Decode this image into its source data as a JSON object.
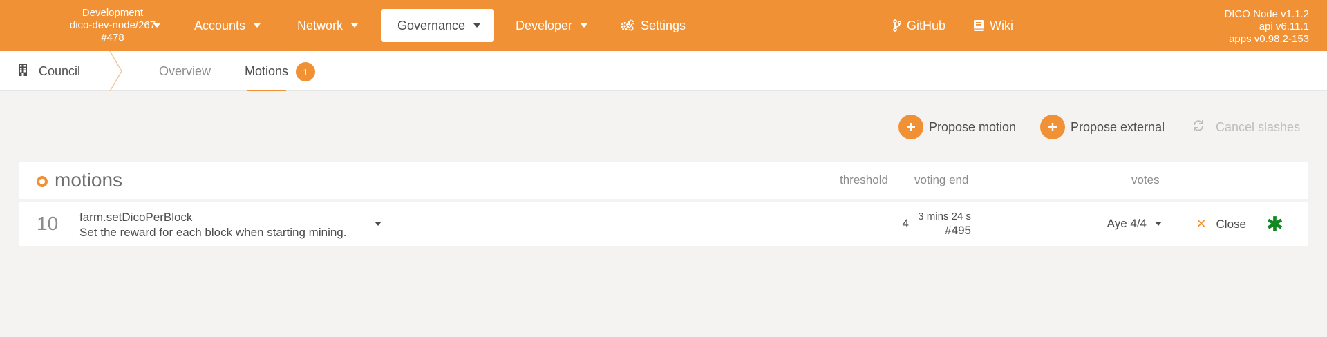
{
  "colors": {
    "brand": "#f19135",
    "success": "#128820",
    "disabled": "#bdbdbd"
  },
  "header": {
    "chain": {
      "line1": "Development",
      "line2": "dico-dev-node/267",
      "line3": "#478"
    },
    "nav": [
      {
        "label": "Accounts"
      },
      {
        "label": "Network"
      },
      {
        "label": "Governance"
      },
      {
        "label": "Developer"
      },
      {
        "label": "Settings",
        "icon": "gears-icon"
      }
    ],
    "links": [
      {
        "label": "GitHub",
        "icon": "code-branch-icon"
      },
      {
        "label": "Wiki",
        "icon": "book-icon"
      }
    ],
    "version": {
      "node": "DICO Node v1.1.2",
      "api": "api v6.11.1",
      "apps": "apps v0.98.2-153"
    }
  },
  "subnav": {
    "section": "Council",
    "tabs": [
      {
        "label": "Overview"
      },
      {
        "label": "Motions"
      }
    ],
    "motions_badge": "1"
  },
  "actions": {
    "propose_motion": "Propose motion",
    "propose_external": "Propose external",
    "cancel_slashes": "Cancel slashes"
  },
  "table": {
    "title": "motions",
    "columns": {
      "threshold": "threshold",
      "voting_end": "voting end",
      "votes": "votes"
    },
    "rows": [
      {
        "index": "10",
        "call": "farm.setDicoPerBlock",
        "description": "Set the reward for each block when starting mining.",
        "threshold": "4",
        "voting_end_time": "3 mins 24 s",
        "voting_end_block": "#495",
        "votes": "Aye 4/4",
        "close_label": "Close"
      }
    ]
  }
}
